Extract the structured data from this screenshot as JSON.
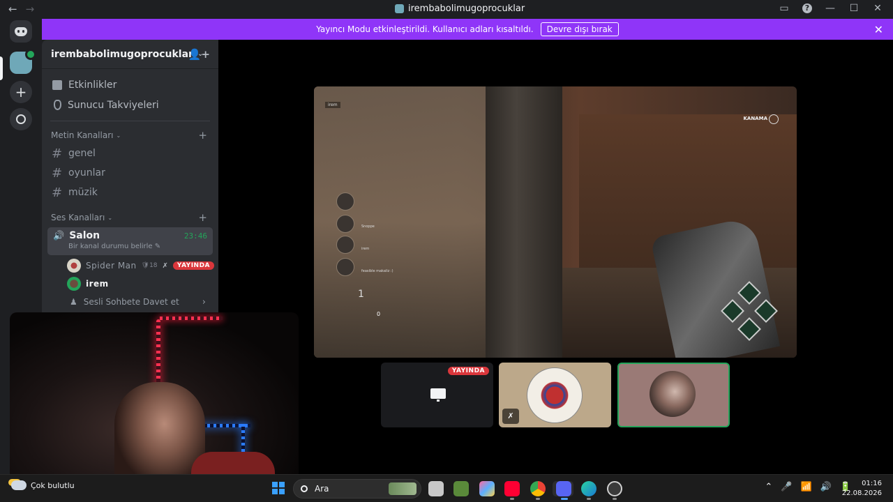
{
  "titlebar": {
    "back": "←",
    "forward": "→",
    "title": "irembabolimugoprocuklar",
    "inbox": "▭",
    "help": "?",
    "minimize": "—",
    "maximize": "☐",
    "close": "✕"
  },
  "banner": {
    "text": "Yayıncı Modu etkinleştirildi. Kullanıcı adları kısaltıldı.",
    "button": "Devre dışı bırak",
    "close": "✕"
  },
  "rail": {
    "add": "+"
  },
  "server": {
    "name": "irembabolimugoprocuklar",
    "chevron": "⌄",
    "invite_icon": "👤+"
  },
  "menu": [
    {
      "label": "Etkinlikler"
    },
    {
      "label": "Sunucu Takviyeleri"
    }
  ],
  "text_category": {
    "label": "Metin Kanalları",
    "chevron": "⌄",
    "plus": "+"
  },
  "text_channels": [
    {
      "hash": "#",
      "name": "genel"
    },
    {
      "hash": "#",
      "name": "oyunlar"
    },
    {
      "hash": "#",
      "name": "müzik"
    }
  ],
  "voice_category": {
    "label": "Ses Kanalları",
    "chevron": "⌄",
    "plus": "+"
  },
  "voice_channel": {
    "icon": "🔊",
    "name": "Salon",
    "time": "23:46",
    "status": "Bir kanal durumu belirle ✎"
  },
  "voice_users": [
    {
      "name": "Spider Man",
      "meta": "🛡18",
      "mute": "✗",
      "live": "YAYINDA"
    },
    {
      "name": "irem"
    }
  ],
  "invite": {
    "icon": "♟",
    "label": "Sesli Sohbete Davet et",
    "arrow": "›"
  },
  "stream": {
    "hud_top": "irem",
    "kanama": "KANAMA",
    "counter": "1",
    "zero": "0",
    "players": [
      {
        "name": "⠀"
      },
      {
        "name": "Snoppe"
      },
      {
        "name": "irem"
      },
      {
        "name": "feasible makaliz :)"
      }
    ]
  },
  "tiles": {
    "screen_live": "YAYINDA",
    "spider_mute": "✗"
  },
  "taskbar": {
    "weather": "Çok bulutlu",
    "search": "Ara",
    "tray": [
      "⌃",
      "🎤",
      "📶",
      "🔊",
      "🔋"
    ],
    "time": "01:16",
    "date": "22.08.2026"
  },
  "colors": {
    "banner": "#8f35f8",
    "online": "#23a55a",
    "live": "#da373c"
  }
}
